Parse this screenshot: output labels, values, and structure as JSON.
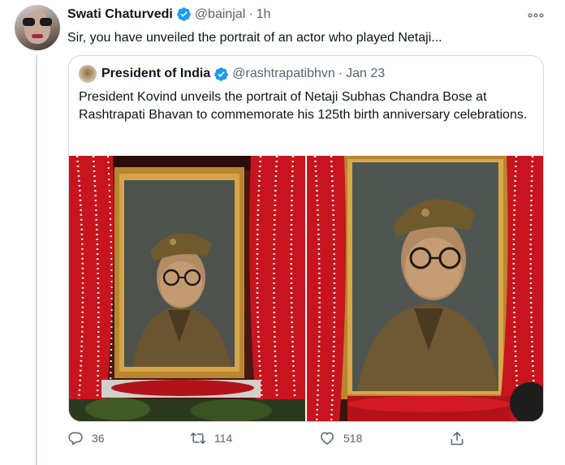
{
  "tweet": {
    "author_name": "Swati Chaturvedi",
    "author_handle": "@bainjal",
    "separator": "·",
    "time": "1h",
    "text": "Sir, you have unveiled the portrait of an actor who played Netaji...",
    "verified": true
  },
  "quoted_tweet": {
    "author_name": "President of India",
    "author_handle": "@rashtrapatibhvn",
    "separator": "·",
    "time": "Jan 23",
    "text": "President Kovind unveils the portrait of Netaji Subhas Chandra Bose at Rashtrapati Bhavan to commemorate his 125th birth anniversary celebrations.",
    "verified": true,
    "media": [
      {
        "icon": "portrait-photo"
      },
      {
        "icon": "portrait-photo-closeup"
      }
    ]
  },
  "actions": {
    "reply_count": "36",
    "retweet_count": "114",
    "like_count": "518"
  },
  "colors": {
    "verified_blue": "#1d9bf0",
    "secondary_text": "#536471",
    "border": "#cfd9de",
    "curtain_red": "#c8141e"
  },
  "icons": {
    "more": "more-horizontal-icon",
    "reply": "reply-icon",
    "retweet": "retweet-icon",
    "like": "heart-icon",
    "share": "share-icon",
    "verified": "verified-badge-icon"
  }
}
